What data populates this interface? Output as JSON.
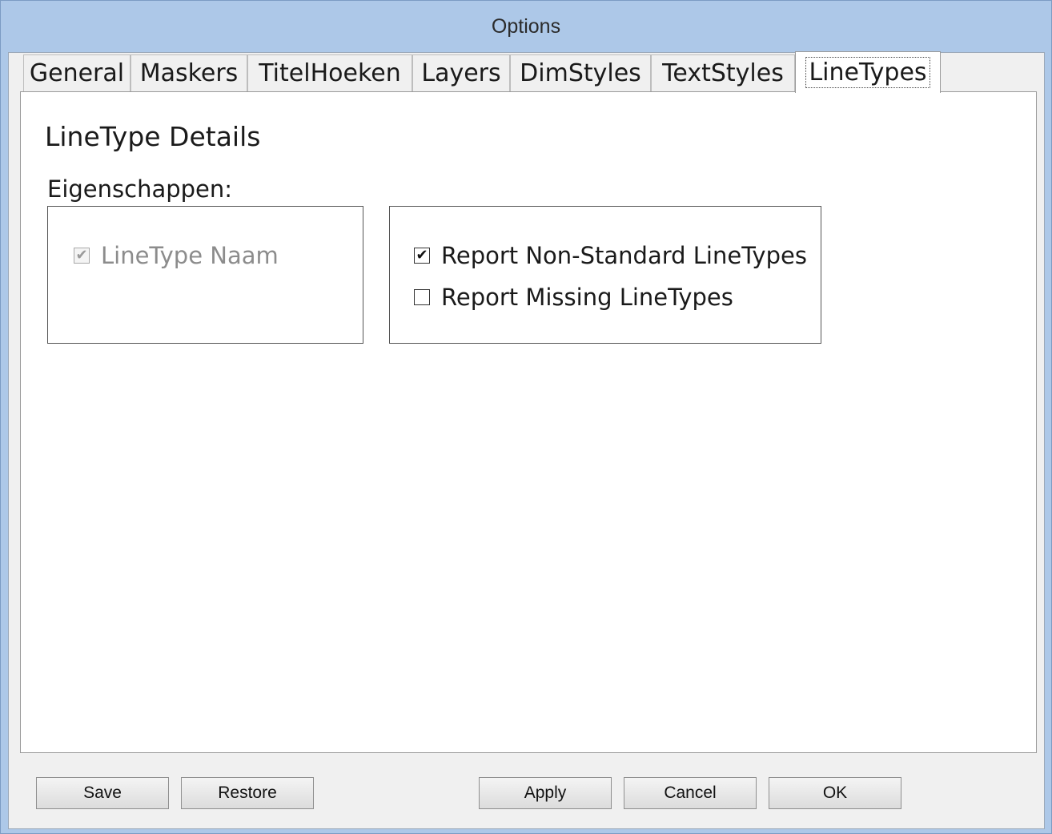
{
  "window": {
    "title": "Options"
  },
  "tabs": [
    {
      "label": "General"
    },
    {
      "label": "Maskers"
    },
    {
      "label": "TitelHoeken"
    },
    {
      "label": "Layers"
    },
    {
      "label": "DimStyles"
    },
    {
      "label": "TextStyles"
    },
    {
      "label": "LineTypes",
      "selected": true
    }
  ],
  "panel": {
    "heading": "LineType Details",
    "properties_label": "Eigenschappen:",
    "left_group": {
      "linetype_name": {
        "label": "LineType Naam",
        "checked": true,
        "enabled": false
      }
    },
    "right_group": {
      "report_non_standard": {
        "label": "Report Non-Standard LineTypes",
        "checked": true
      },
      "report_missing": {
        "label": "Report Missing LineTypes",
        "checked": false
      }
    }
  },
  "buttons": {
    "save": "Save",
    "restore": "Restore",
    "apply": "Apply",
    "cancel": "Cancel",
    "ok": "OK"
  },
  "colors": {
    "titlebar": "#adc8e8",
    "dialog_background": "#f0f0f0",
    "panel_background": "#ffffff"
  }
}
